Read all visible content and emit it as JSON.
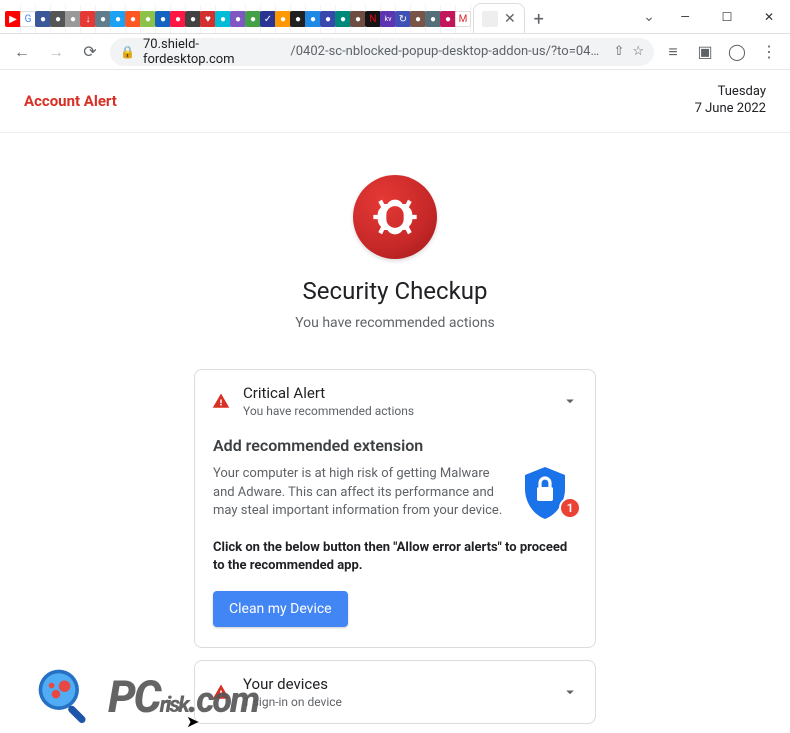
{
  "window": {
    "dropdown_glyph": "⌄",
    "minimize_glyph": "—",
    "maximize_glyph": "☐",
    "close_glyph": "✕",
    "newtab_glyph": "+"
  },
  "mini_tabs": [
    {
      "bg": "#ff0000",
      "glyph": "▶"
    },
    {
      "bg": "#ffffff",
      "glyph": "G",
      "fg": "#4285f4"
    },
    {
      "bg": "#3b5998",
      "glyph": "●"
    },
    {
      "bg": "#555555",
      "glyph": "●"
    },
    {
      "bg": "#999999",
      "glyph": "●"
    },
    {
      "bg": "#e53935",
      "glyph": "↓"
    },
    {
      "bg": "#607d8b",
      "glyph": "●"
    },
    {
      "bg": "#1da1f2",
      "glyph": "●"
    },
    {
      "bg": "#ff5722",
      "glyph": "●"
    },
    {
      "bg": "#8bc34a",
      "glyph": "●"
    },
    {
      "bg": "#1565c0",
      "glyph": "●"
    },
    {
      "bg": "#ff1744",
      "glyph": "●"
    },
    {
      "bg": "#424242",
      "glyph": "●"
    },
    {
      "bg": "#d32f2f",
      "glyph": "♥"
    },
    {
      "bg": "#00bcd4",
      "glyph": "●"
    },
    {
      "bg": "#7e57c2",
      "glyph": "●"
    },
    {
      "bg": "#43a047",
      "glyph": "●"
    },
    {
      "bg": "#283593",
      "glyph": "✓"
    },
    {
      "bg": "#ff9800",
      "glyph": "●"
    },
    {
      "bg": "#212121",
      "glyph": "●"
    },
    {
      "bg": "#1e88e5",
      "glyph": "●"
    },
    {
      "bg": "#3949ab",
      "glyph": "●"
    },
    {
      "bg": "#00897b",
      "glyph": "●"
    },
    {
      "bg": "#6d4c41",
      "glyph": "●"
    },
    {
      "bg": "#141414",
      "glyph": "N",
      "fg": "#e50914"
    },
    {
      "bg": "#5e35b1",
      "glyph": "kv",
      "fs": "7px"
    },
    {
      "bg": "#3f51b5",
      "glyph": "↻"
    },
    {
      "bg": "#795548",
      "glyph": "●"
    },
    {
      "bg": "#546e7a",
      "glyph": "●"
    },
    {
      "bg": "#c2185b",
      "glyph": "●"
    },
    {
      "bg": "#ffffff",
      "glyph": "M",
      "fg": "#d7282f"
    }
  ],
  "active_tab": {
    "close_glyph": "✕"
  },
  "toolbar": {
    "back_glyph": "←",
    "forward_glyph": "→",
    "reload_glyph": "⟳",
    "lock_glyph": "🔒",
    "domain": "70.shield-fordesktop.com",
    "path": "/0402-sc-nblocked-popup-desktop-addon-us/?to=0402-s…",
    "share_glyph": "⇧",
    "star_glyph": "☆",
    "ext_glyph": "≡",
    "panel_glyph": "▣",
    "profile_glyph": "◯",
    "menu_glyph": "⋮"
  },
  "header": {
    "title": "Account Alert",
    "day": "Tuesday",
    "date": "7 June 2022"
  },
  "hero": {
    "title": "Security Checkup",
    "subtitle": "You have recommended actions"
  },
  "card1": {
    "title": "Critical Alert",
    "subtitle": "You have recommended actions",
    "section_title": "Add recommended extension",
    "body_text": "Your computer is at high risk of getting Malware and Adware. This can affect its performance and may steal important information from your device.",
    "badge_count": "1",
    "bold_note": "Click on the below button then \"Allow error alerts\" to proceed to the recommended app.",
    "cta_label": "Clean my Device"
  },
  "card2": {
    "title": "Your devices",
    "subtitle": "1 sign-in on device"
  },
  "watermark": {
    "p": "P",
    "c": "C",
    "risk": "risk",
    "dotcom": ".com"
  }
}
